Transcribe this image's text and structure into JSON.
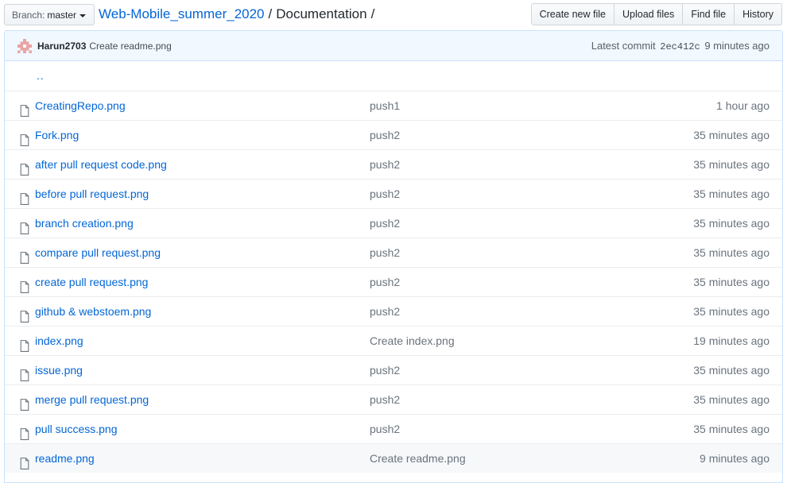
{
  "header": {
    "branch_prefix": "Branch:",
    "branch_name": "master",
    "breadcrumb_repo": "Web-Mobile_summer_2020",
    "breadcrumb_sep1": "/",
    "breadcrumb_dir": "Documentation",
    "breadcrumb_sep2": "/",
    "buttons": {
      "create_new_file": "Create new file",
      "upload_files": "Upload files",
      "find_file": "Find file",
      "history": "History"
    }
  },
  "commit": {
    "author": "Harun2703",
    "message": "Create readme.png",
    "latest_label": "Latest commit",
    "sha": "2ec412c",
    "age": "9 minutes ago"
  },
  "parent_link": "..",
  "files": [
    {
      "name": "CreatingRepo.png",
      "message": "push1",
      "age": "1 hour ago"
    },
    {
      "name": "Fork.png",
      "message": "push2",
      "age": "35 minutes ago"
    },
    {
      "name": "after pull request code.png",
      "message": "push2",
      "age": "35 minutes ago"
    },
    {
      "name": "before pull request.png",
      "message": "push2",
      "age": "35 minutes ago"
    },
    {
      "name": "branch creation.png",
      "message": "push2",
      "age": "35 minutes ago"
    },
    {
      "name": "compare pull request.png",
      "message": "push2",
      "age": "35 minutes ago"
    },
    {
      "name": "create pull request.png",
      "message": "push2",
      "age": "35 minutes ago"
    },
    {
      "name": "github & webstoem.png",
      "message": "push2",
      "age": "35 minutes ago"
    },
    {
      "name": "index.png",
      "message": "Create index.png",
      "age": "19 minutes ago"
    },
    {
      "name": "issue.png",
      "message": "push2",
      "age": "35 minutes ago"
    },
    {
      "name": "merge pull request.png",
      "message": "push2",
      "age": "35 minutes ago"
    },
    {
      "name": "pull success.png",
      "message": "push2",
      "age": "35 minutes ago"
    },
    {
      "name": "readme.png",
      "message": "Create readme.png",
      "age": "9 minutes ago"
    }
  ],
  "icons": {
    "file": "file-icon",
    "avatar": "identicon-avatar",
    "caret": "caret-down-icon"
  },
  "colors": {
    "link": "#0366d6",
    "commit_bar": "#f1f8ff",
    "border": "#c8e1ff",
    "avatar": "#e8a5a5"
  }
}
